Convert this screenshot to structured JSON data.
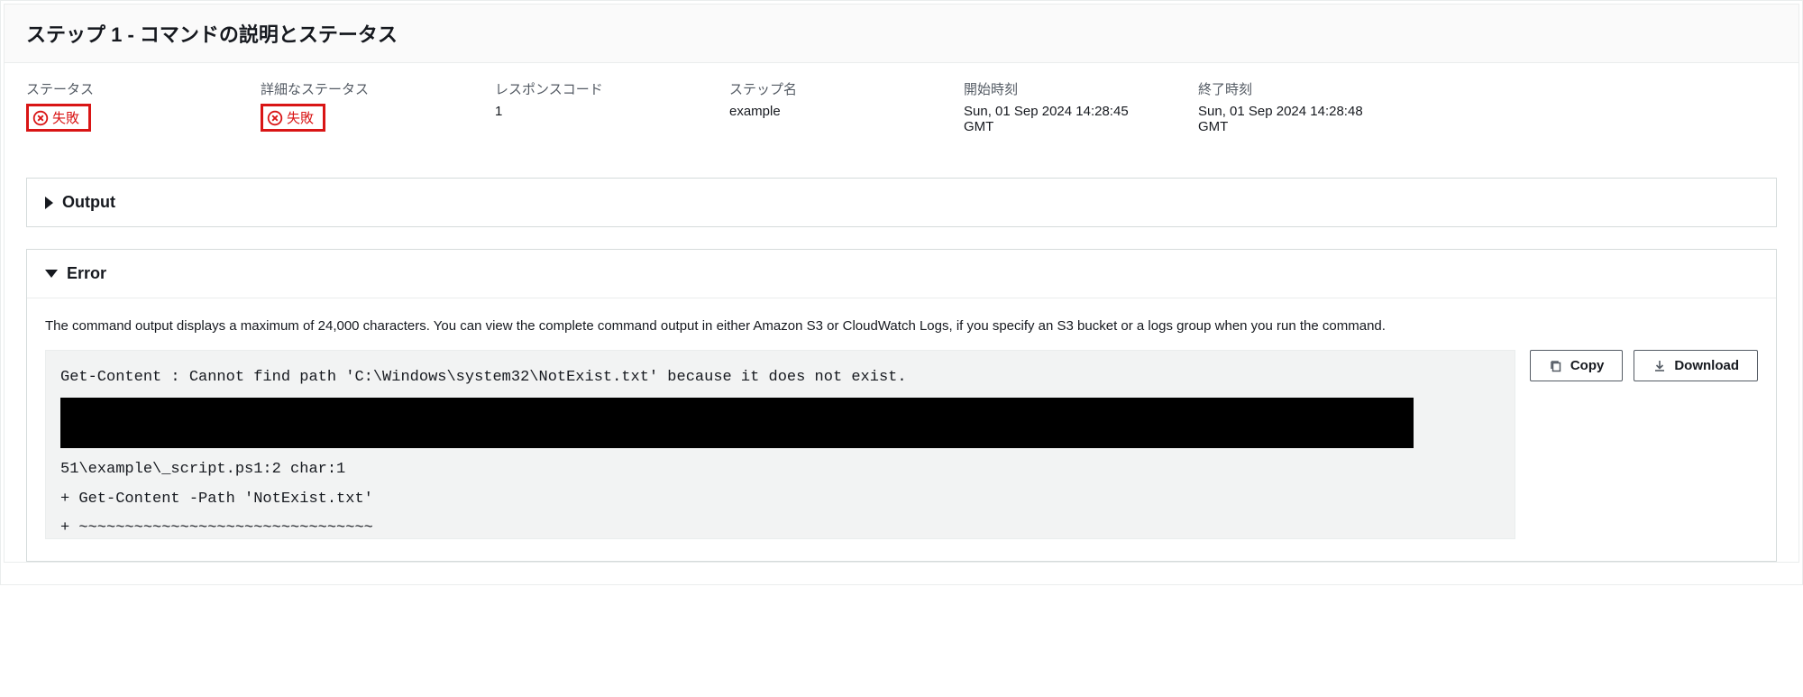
{
  "header": {
    "title": "ステップ 1 - コマンドの説明とステータス"
  },
  "status": {
    "status_label": "ステータス",
    "status_value": "失敗",
    "detailed_label": "詳細なステータス",
    "detailed_value": "失敗",
    "response_label": "レスポンスコード",
    "response_value": "1",
    "step_label": "ステップ名",
    "step_value": "example",
    "start_label": "開始時刻",
    "start_value": "Sun, 01 Sep 2024 14:28:45 GMT",
    "end_label": "終了時刻",
    "end_value": "Sun, 01 Sep 2024 14:28:48 GMT"
  },
  "output": {
    "title": "Output"
  },
  "error": {
    "title": "Error",
    "help": "The command output displays a maximum of 24,000 characters. You can view the complete command output in either Amazon S3 or CloudWatch Logs, if you specify an S3 bucket or a logs group when you run the command.",
    "code_lines": {
      "l1": "Get-Content : Cannot find path 'C:\\Windows\\system32\\NotExist.txt' because it does not exist.",
      "l2": "51\\example\\_script.ps1:2 char:1",
      "l3": "+ Get-Content -Path 'NotExist.txt'",
      "l4": "+ ~~~~~~~~~~~~~~~~~~~~~~~~~~~~~~~~"
    },
    "copy_label": "Copy",
    "download_label": "Download"
  }
}
